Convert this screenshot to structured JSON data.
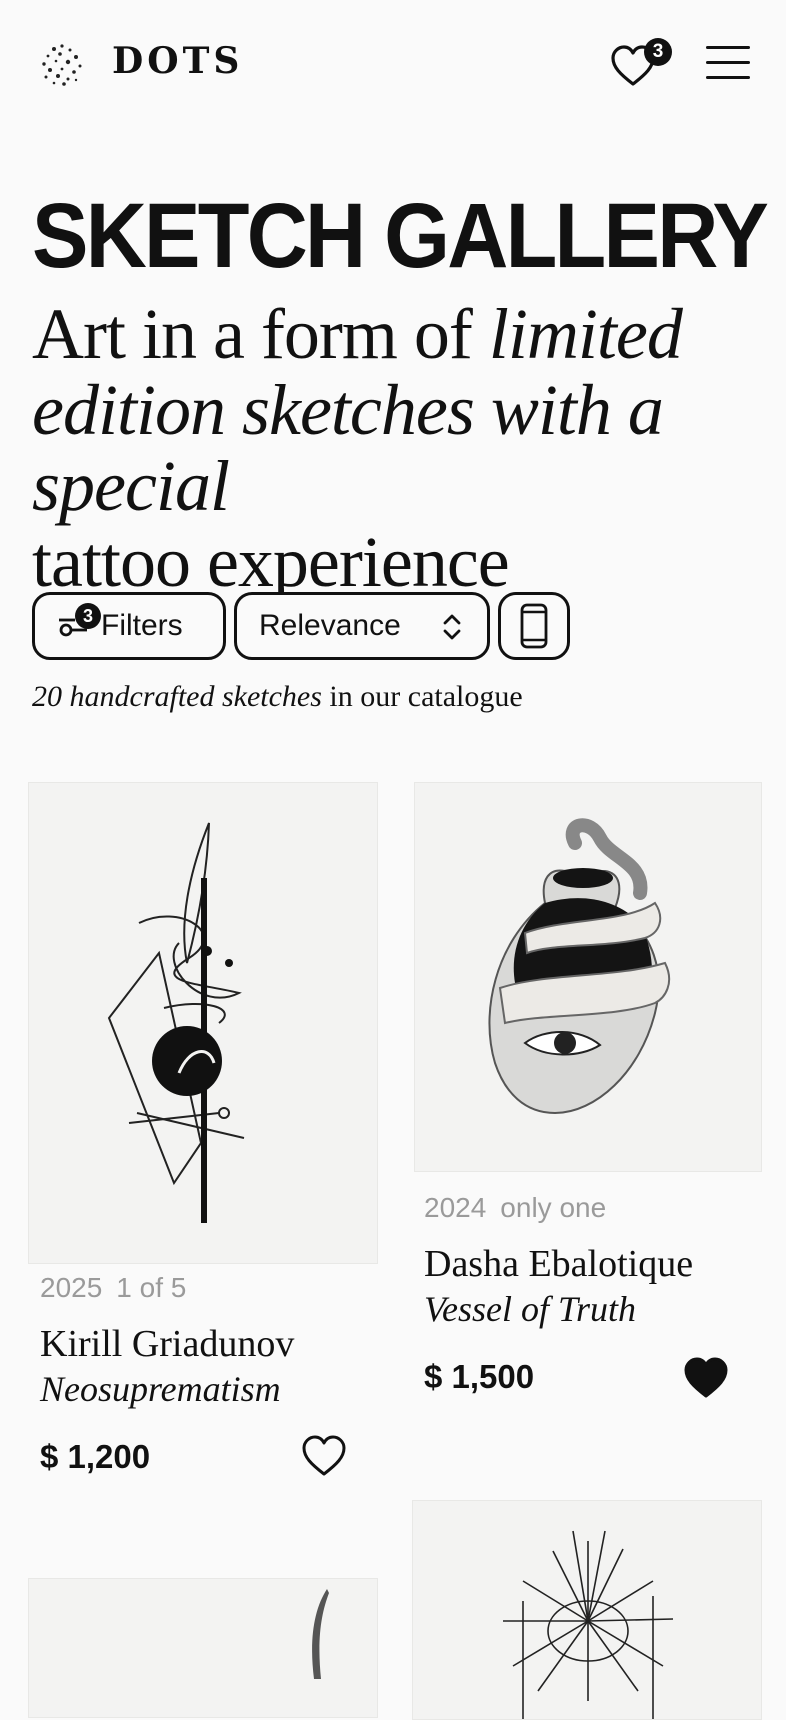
{
  "brand": {
    "name": "DOTS"
  },
  "header": {
    "favorites_count": "3"
  },
  "page": {
    "title": "SKETCH GALLERY",
    "lead_part1": "Art in a form of ",
    "lead_italic": "limited edition sketches with a special",
    "lead_part2": "tattoo experience"
  },
  "toolbar": {
    "filters_label": "Filters",
    "filters_count": "3",
    "sort_label": "Relevance"
  },
  "catalog": {
    "count_italic": "20 handcrafted sketches",
    "count_rest": " in our catalogue"
  },
  "products": [
    {
      "year": "2025",
      "edition": "1 of 5",
      "artist": "Kirill Griadunov",
      "title": "Neosuprematism",
      "price": "$ 1,200",
      "favorited": false
    },
    {
      "year": "2024",
      "edition": "only one",
      "artist": "Dasha Ebalotique",
      "title": "Vessel of Truth",
      "price": "$ 1,500",
      "favorited": true
    }
  ],
  "colors": {
    "ink": "#111111",
    "background": "#fafafa",
    "muted": "#9a9a9a",
    "card": "#f3f3f2"
  },
  "icons": [
    "dots-logo-icon",
    "heart-icon",
    "menu-icon",
    "filter-icon",
    "sort-chevron-icon",
    "phone-view-icon"
  ]
}
